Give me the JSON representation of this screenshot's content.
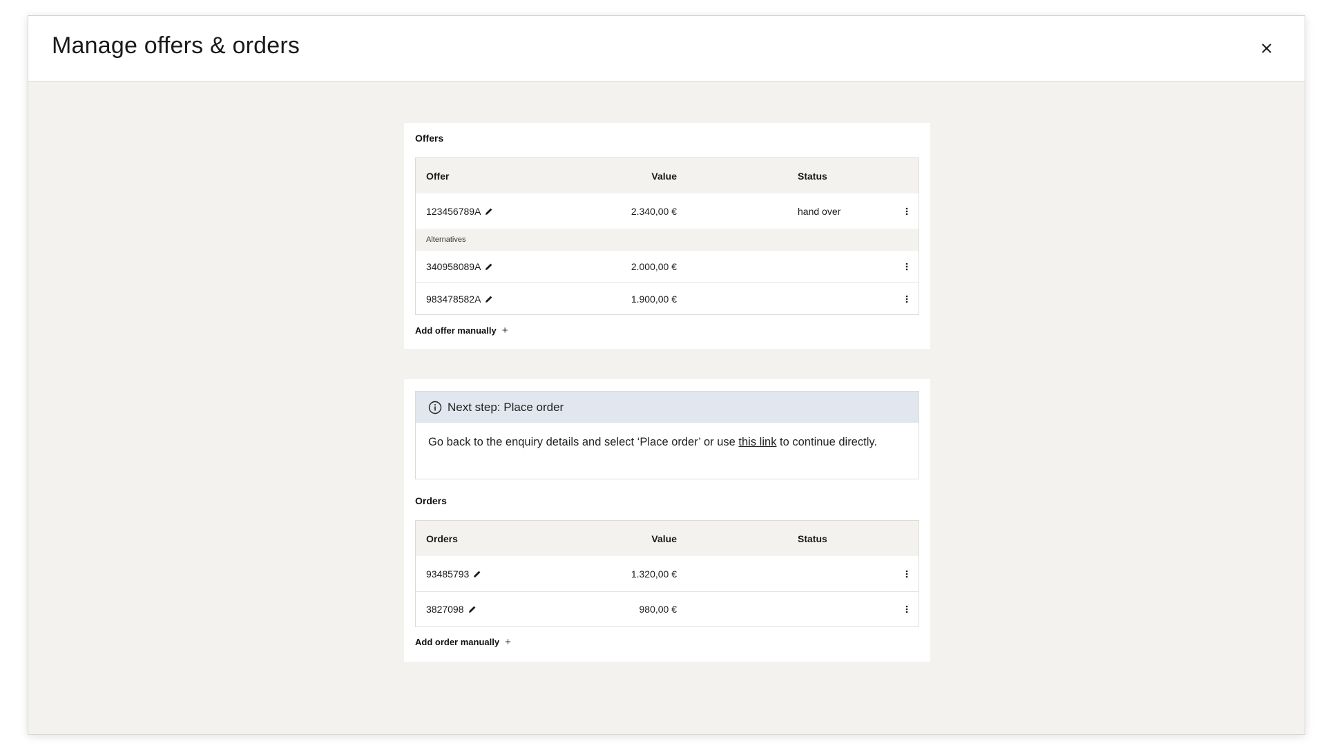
{
  "modal": {
    "title": "Manage offers & orders"
  },
  "offers": {
    "section_title": "Offers",
    "columns": {
      "name": "Offer",
      "value": "Value",
      "status": "Status"
    },
    "primary": {
      "id": "123456789A",
      "value": "2.340,00 €",
      "status": "hand over"
    },
    "alternatives_label": "Alternatives",
    "alternatives": [
      {
        "id": "340958089A",
        "value": "2.000,00 €",
        "status": ""
      },
      {
        "id": "983478582A",
        "value": "1.900,00 €",
        "status": ""
      }
    ],
    "add_label": "Add offer manually",
    "add_icon": "+"
  },
  "notice": {
    "title": "Next step: Place order",
    "body_before": "Go back to the enquiry details and select ‘Place order’ or use ",
    "link_text": "this link",
    "body_after": " to continue directly.",
    "icon": "info-icon"
  },
  "orders": {
    "section_title": "Orders",
    "columns": {
      "name": "Orders",
      "value": "Value",
      "status": "Status"
    },
    "rows": [
      {
        "id": "93485793",
        "value": "1.320,00 €",
        "status": ""
      },
      {
        "id": "3827098",
        "value": "980,00 €",
        "status": ""
      }
    ],
    "add_label": "Add order manually",
    "add_icon": "+"
  },
  "colors": {
    "background": "#f3f2ee",
    "card": "#ffffff",
    "notice_header": "#e1e6ef",
    "border": "#dcdbd6"
  }
}
